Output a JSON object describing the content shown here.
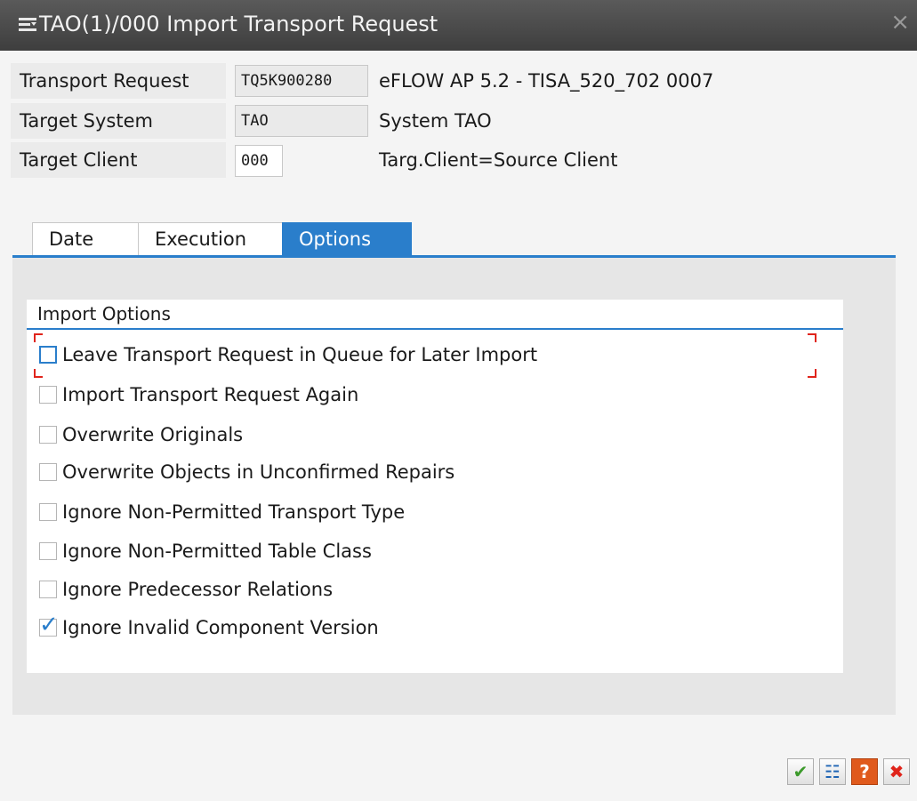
{
  "window": {
    "title": "TAO(1)/000 Import Transport Request",
    "close_glyph": "×"
  },
  "fields": {
    "transport_request": {
      "label": "Transport Request",
      "value": "TQ5K900280",
      "description": "eFLOW AP 5.2 - TISA_520_702 0007"
    },
    "target_system": {
      "label": "Target System",
      "value": "TAO",
      "description": "System TAO"
    },
    "target_client": {
      "label": "Target Client",
      "value": "000",
      "description": "Targ.Client=Source Client"
    }
  },
  "tabs": [
    {
      "label": "Date",
      "active": false
    },
    {
      "label": "Execution",
      "active": false
    },
    {
      "label": "Options",
      "active": true
    }
  ],
  "import_options": {
    "title": "Import Options",
    "items": [
      {
        "label": "Leave Transport Request in Queue for Later Import",
        "checked": false
      },
      {
        "label": "Import Transport Request Again",
        "checked": false
      },
      {
        "label": "Overwrite Originals",
        "checked": false
      },
      {
        "label": "Overwrite Objects in Unconfirmed Repairs",
        "checked": false
      },
      {
        "label": "Ignore Non-Permitted Transport Type",
        "checked": false
      },
      {
        "label": "Ignore Non-Permitted Table Class",
        "checked": false
      },
      {
        "label": "Ignore Predecessor Relations",
        "checked": false
      },
      {
        "label": "Ignore Invalid Component Version",
        "checked": true
      }
    ]
  },
  "footer_buttons": [
    {
      "icon": "check-icon",
      "glyph": "✔",
      "color": "#3c9a2b"
    },
    {
      "icon": "transport-icon",
      "glyph": "☷",
      "color": "#1e64b4"
    },
    {
      "icon": "help-icon",
      "glyph": "?",
      "color": "#ffffff"
    },
    {
      "icon": "cancel-icon",
      "glyph": "✖",
      "color": "#e0241b"
    }
  ],
  "colors": {
    "accent": "#2a7ecb",
    "focus": "#e0241b",
    "titlebar": "#4a4a4a"
  }
}
